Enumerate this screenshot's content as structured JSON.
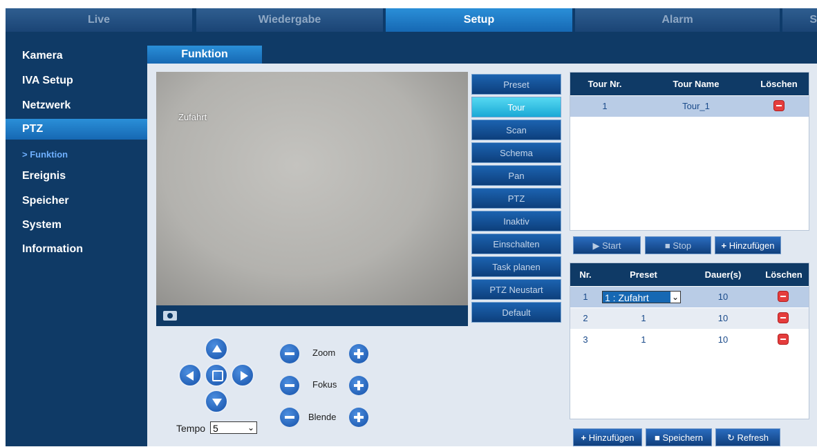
{
  "topnav": {
    "tabs": [
      {
        "label": "Live"
      },
      {
        "label": "Wiedergabe"
      },
      {
        "label": "Setup"
      },
      {
        "label": "Alarm"
      },
      {
        "label": "S"
      }
    ],
    "active": "Setup"
  },
  "sidebar": {
    "items": [
      {
        "label": "Kamera"
      },
      {
        "label": "IVA Setup"
      },
      {
        "label": "Netzwerk"
      },
      {
        "label": "PTZ"
      },
      {
        "label": "> Funktion"
      },
      {
        "label": "Ereignis"
      },
      {
        "label": "Speicher"
      },
      {
        "label": "System"
      },
      {
        "label": "Information"
      }
    ]
  },
  "header": {
    "tab": "Funktion"
  },
  "video": {
    "overlay": "Zufahrt"
  },
  "functions": [
    "Preset",
    "Tour",
    "Scan",
    "Schema",
    "Pan",
    "PTZ",
    "Inaktiv",
    "Einschalten",
    "Task planen",
    "PTZ Neustart",
    "Default"
  ],
  "tour": {
    "headers": [
      "Tour Nr.",
      "Tour Name",
      "Löschen"
    ],
    "rows": [
      {
        "nr": "1",
        "name": "Tour_1"
      }
    ],
    "buttons": {
      "start": "Start",
      "stop": "Stop",
      "add": "Hinzufügen"
    }
  },
  "preset": {
    "headers": [
      "Nr.",
      "Preset",
      "Dauer(s)",
      "Löschen"
    ],
    "rows": [
      {
        "nr": "1",
        "preset": "1 : Zufahrt",
        "dauer": "10"
      },
      {
        "nr": "2",
        "preset": "1",
        "dauer": "10"
      },
      {
        "nr": "3",
        "preset": "1",
        "dauer": "10"
      }
    ],
    "buttons": {
      "add": "Hinzufügen",
      "save": "Speichern",
      "refresh": "Refresh"
    }
  },
  "ptz": {
    "zoom": "Zoom",
    "fokus": "Fokus",
    "blende": "Blende",
    "tempo_label": "Tempo",
    "tempo_value": "5"
  },
  "colors": {
    "nav_dark": "#0f3a66",
    "accent": "#1a78c8",
    "tour_active": "#1aa9d6",
    "delete": "#e53d3d"
  }
}
